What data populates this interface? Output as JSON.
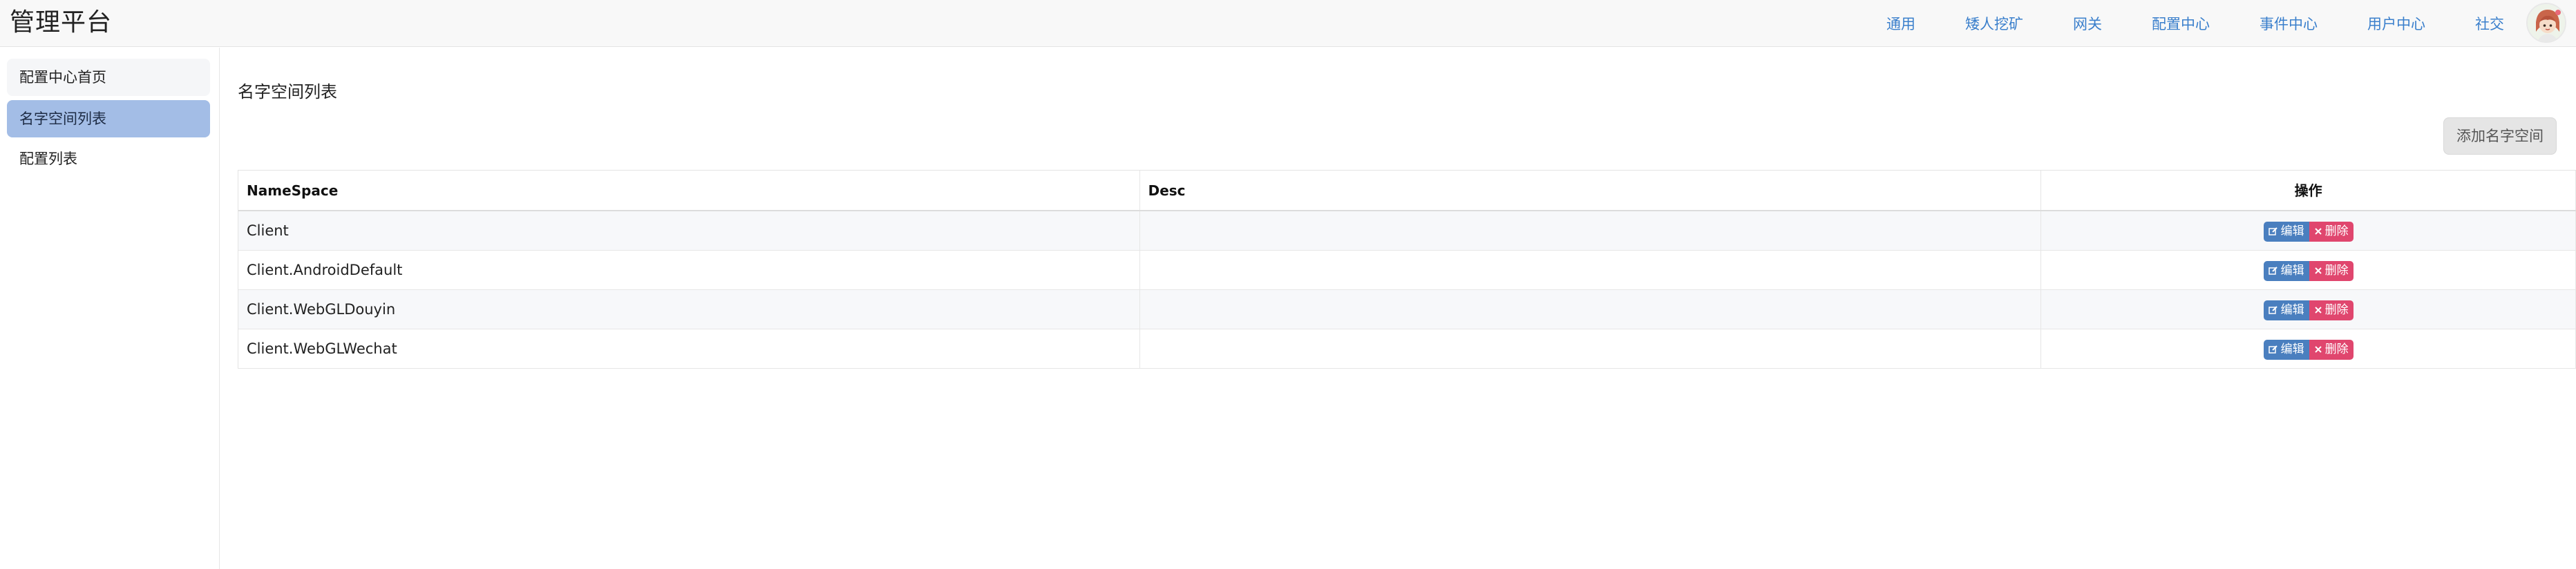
{
  "header": {
    "brand": "管理平台",
    "nav": [
      "通用",
      "矮人挖矿",
      "网关",
      "配置中心",
      "事件中心",
      "用户中心",
      "社交"
    ]
  },
  "sidebar": {
    "items": [
      {
        "label": "配置中心首页"
      },
      {
        "label": "名字空间列表"
      },
      {
        "label": "配置列表"
      }
    ]
  },
  "main": {
    "title": "名字空间列表",
    "add_button": "添加名字空间",
    "table": {
      "columns": [
        "NameSpace",
        "Desc",
        "操作"
      ],
      "rows": [
        {
          "namespace": "Client",
          "desc": ""
        },
        {
          "namespace": "Client.AndroidDefault",
          "desc": ""
        },
        {
          "namespace": "Client.WebGLDouyin",
          "desc": ""
        },
        {
          "namespace": "Client.WebGLWechat",
          "desc": ""
        }
      ],
      "edit_label": "编辑",
      "delete_label": "删除"
    }
  },
  "colors": {
    "accent_link": "#3a7fcc",
    "sidebar_active": "#a3bde6",
    "edit_button": "#4a7fbf",
    "delete_button": "#e0466e"
  },
  "icons": {
    "edit": "edit-icon",
    "delete": "close-icon",
    "avatar": "avatar-image"
  }
}
